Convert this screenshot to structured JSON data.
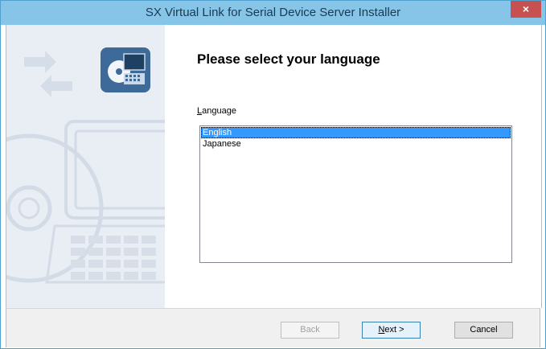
{
  "window": {
    "title": "SX Virtual Link for Serial Device Server Installer",
    "close_glyph": "×"
  },
  "page": {
    "heading": "Please select your language",
    "language_label_mnemonic": "L",
    "language_label_rest": "anguage"
  },
  "languages": [
    {
      "label": "English",
      "selected": true
    },
    {
      "label": "Japanese",
      "selected": false
    }
  ],
  "buttons": {
    "back": "Back",
    "next_mnemonic": "N",
    "next_rest": "ext >",
    "cancel": "Cancel"
  },
  "colors": {
    "titlebar": "#86c5e8",
    "selection": "#3399ff",
    "close": "#c75050"
  },
  "icons": [
    "network-arrows-icon",
    "computer-cd-icon",
    "laptop-cd-watermark"
  ]
}
